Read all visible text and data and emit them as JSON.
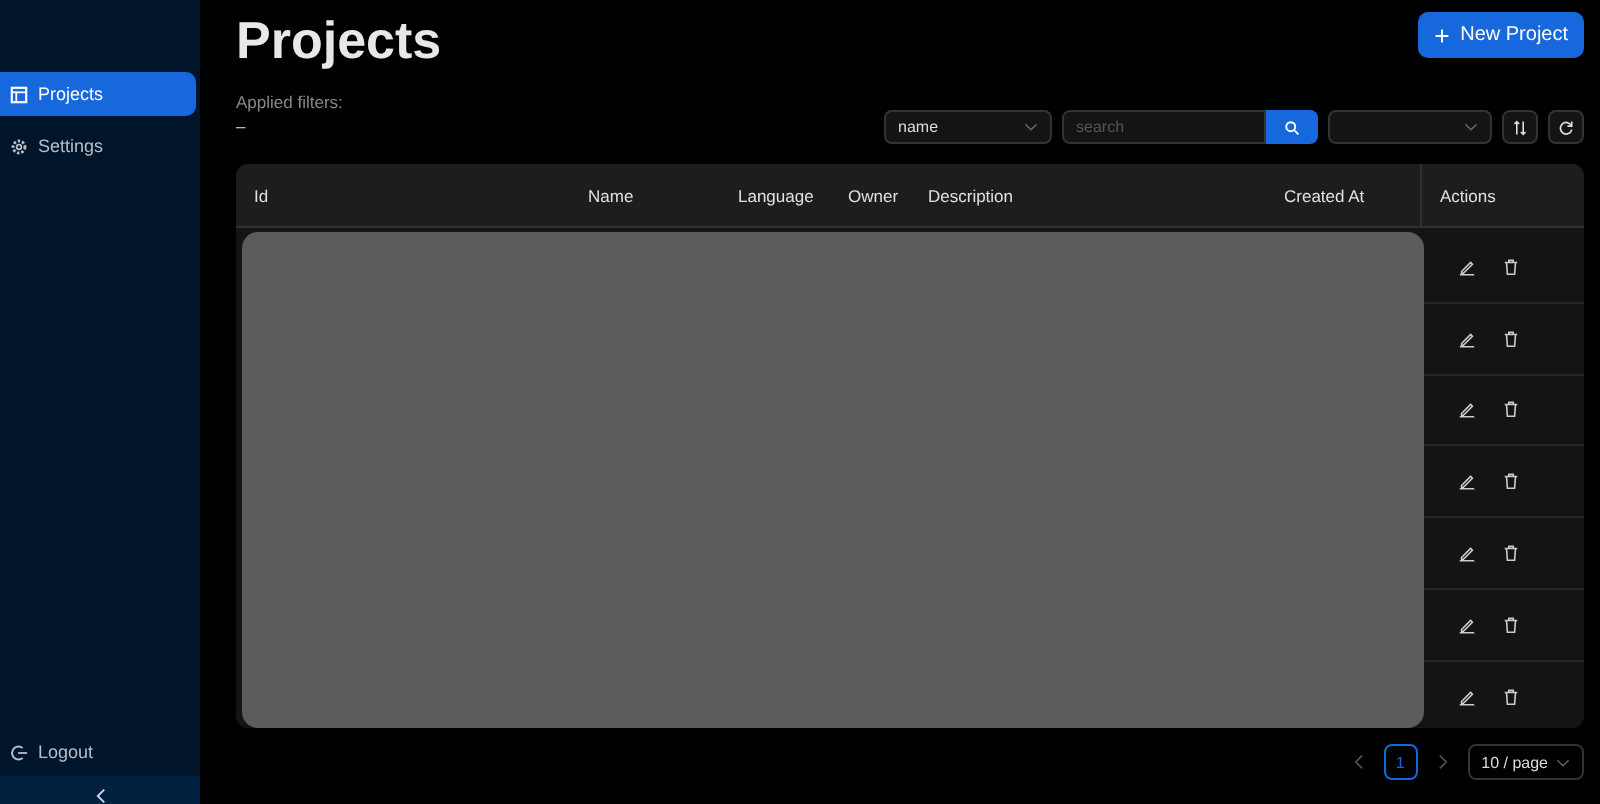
{
  "sidebar": {
    "items": [
      {
        "label": "Projects",
        "selected": true
      },
      {
        "label": "Settings",
        "selected": false
      }
    ],
    "logout": "Logout"
  },
  "title": "Projects",
  "new_button": "New Project",
  "applied_filters": {
    "label": "Applied filters:",
    "value": "–"
  },
  "filters": {
    "field": "name",
    "search_placeholder": "search"
  },
  "table": {
    "columns": [
      "Id",
      "Name",
      "Language",
      "Owner",
      "Description",
      "Created At",
      "Actions"
    ],
    "rows": [
      {
        "redacted": true
      },
      {
        "redacted": true
      },
      {
        "redacted": true
      },
      {
        "redacted": true
      },
      {
        "redacted": true
      },
      {
        "redacted": true
      },
      {
        "redacted": true
      }
    ]
  },
  "pagination": {
    "pages": [
      {
        "label": "1",
        "selected": true
      }
    ],
    "page_size": "10 / page"
  }
}
